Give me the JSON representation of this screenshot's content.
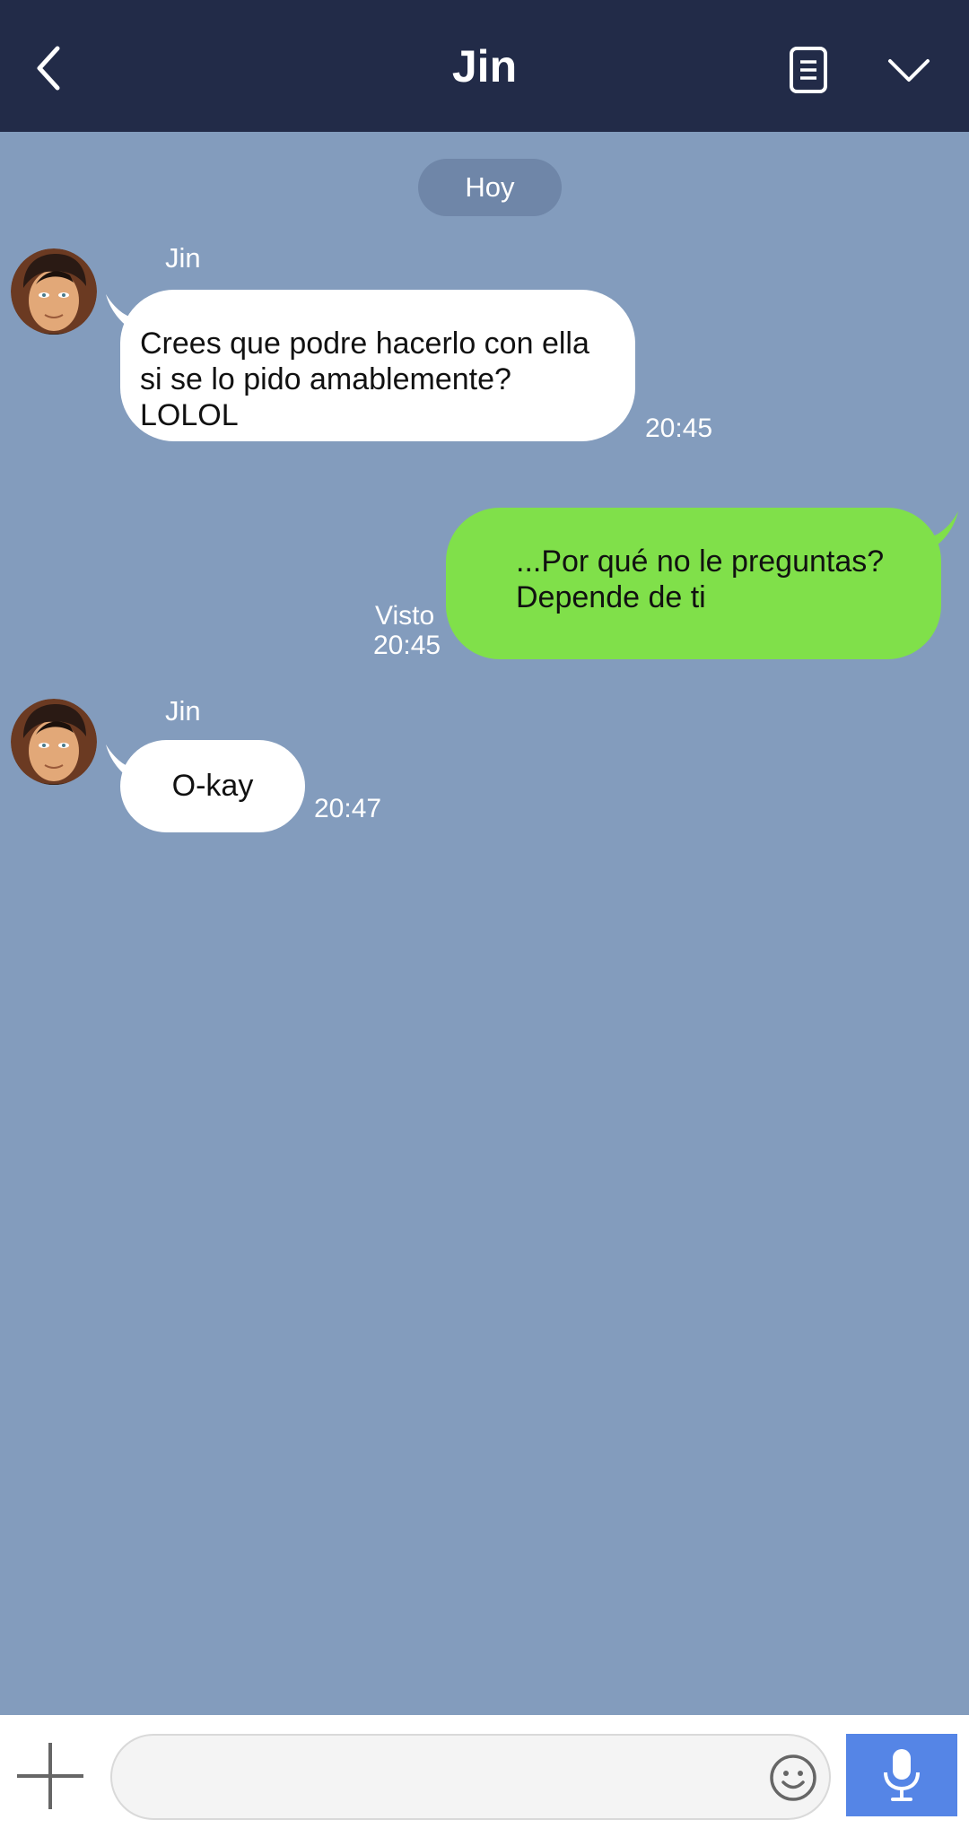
{
  "header": {
    "title": "Jin",
    "back_icon": "chevron-left-icon",
    "notes_icon": "document-icon",
    "menu_icon": "chevron-down-icon",
    "background": "#222b48"
  },
  "chat": {
    "background": "#839cbd",
    "date_label": "Hoy",
    "messages": [
      {
        "direction": "incoming",
        "sender": "Jin",
        "lines": [
          "Crees que podre hacerlo con ella",
          "si se lo pido amablemente? LOLOL"
        ],
        "time": "20:45"
      },
      {
        "direction": "outgoing",
        "lines": [
          "...Por qué no le preguntas?",
          "Depende de ti"
        ],
        "status": "Visto",
        "time": "20:45"
      },
      {
        "direction": "incoming",
        "sender": "Jin",
        "lines": [
          "O-kay"
        ],
        "time": "20:47"
      }
    ]
  },
  "composer": {
    "add_icon": "plus-icon",
    "emoji_icon": "smiley-icon",
    "mic_icon": "microphone-icon",
    "placeholder": "",
    "mic_color": "#5585e6"
  },
  "colors": {
    "incoming_bubble": "#ffffff",
    "outgoing_bubble": "#80e04a"
  }
}
